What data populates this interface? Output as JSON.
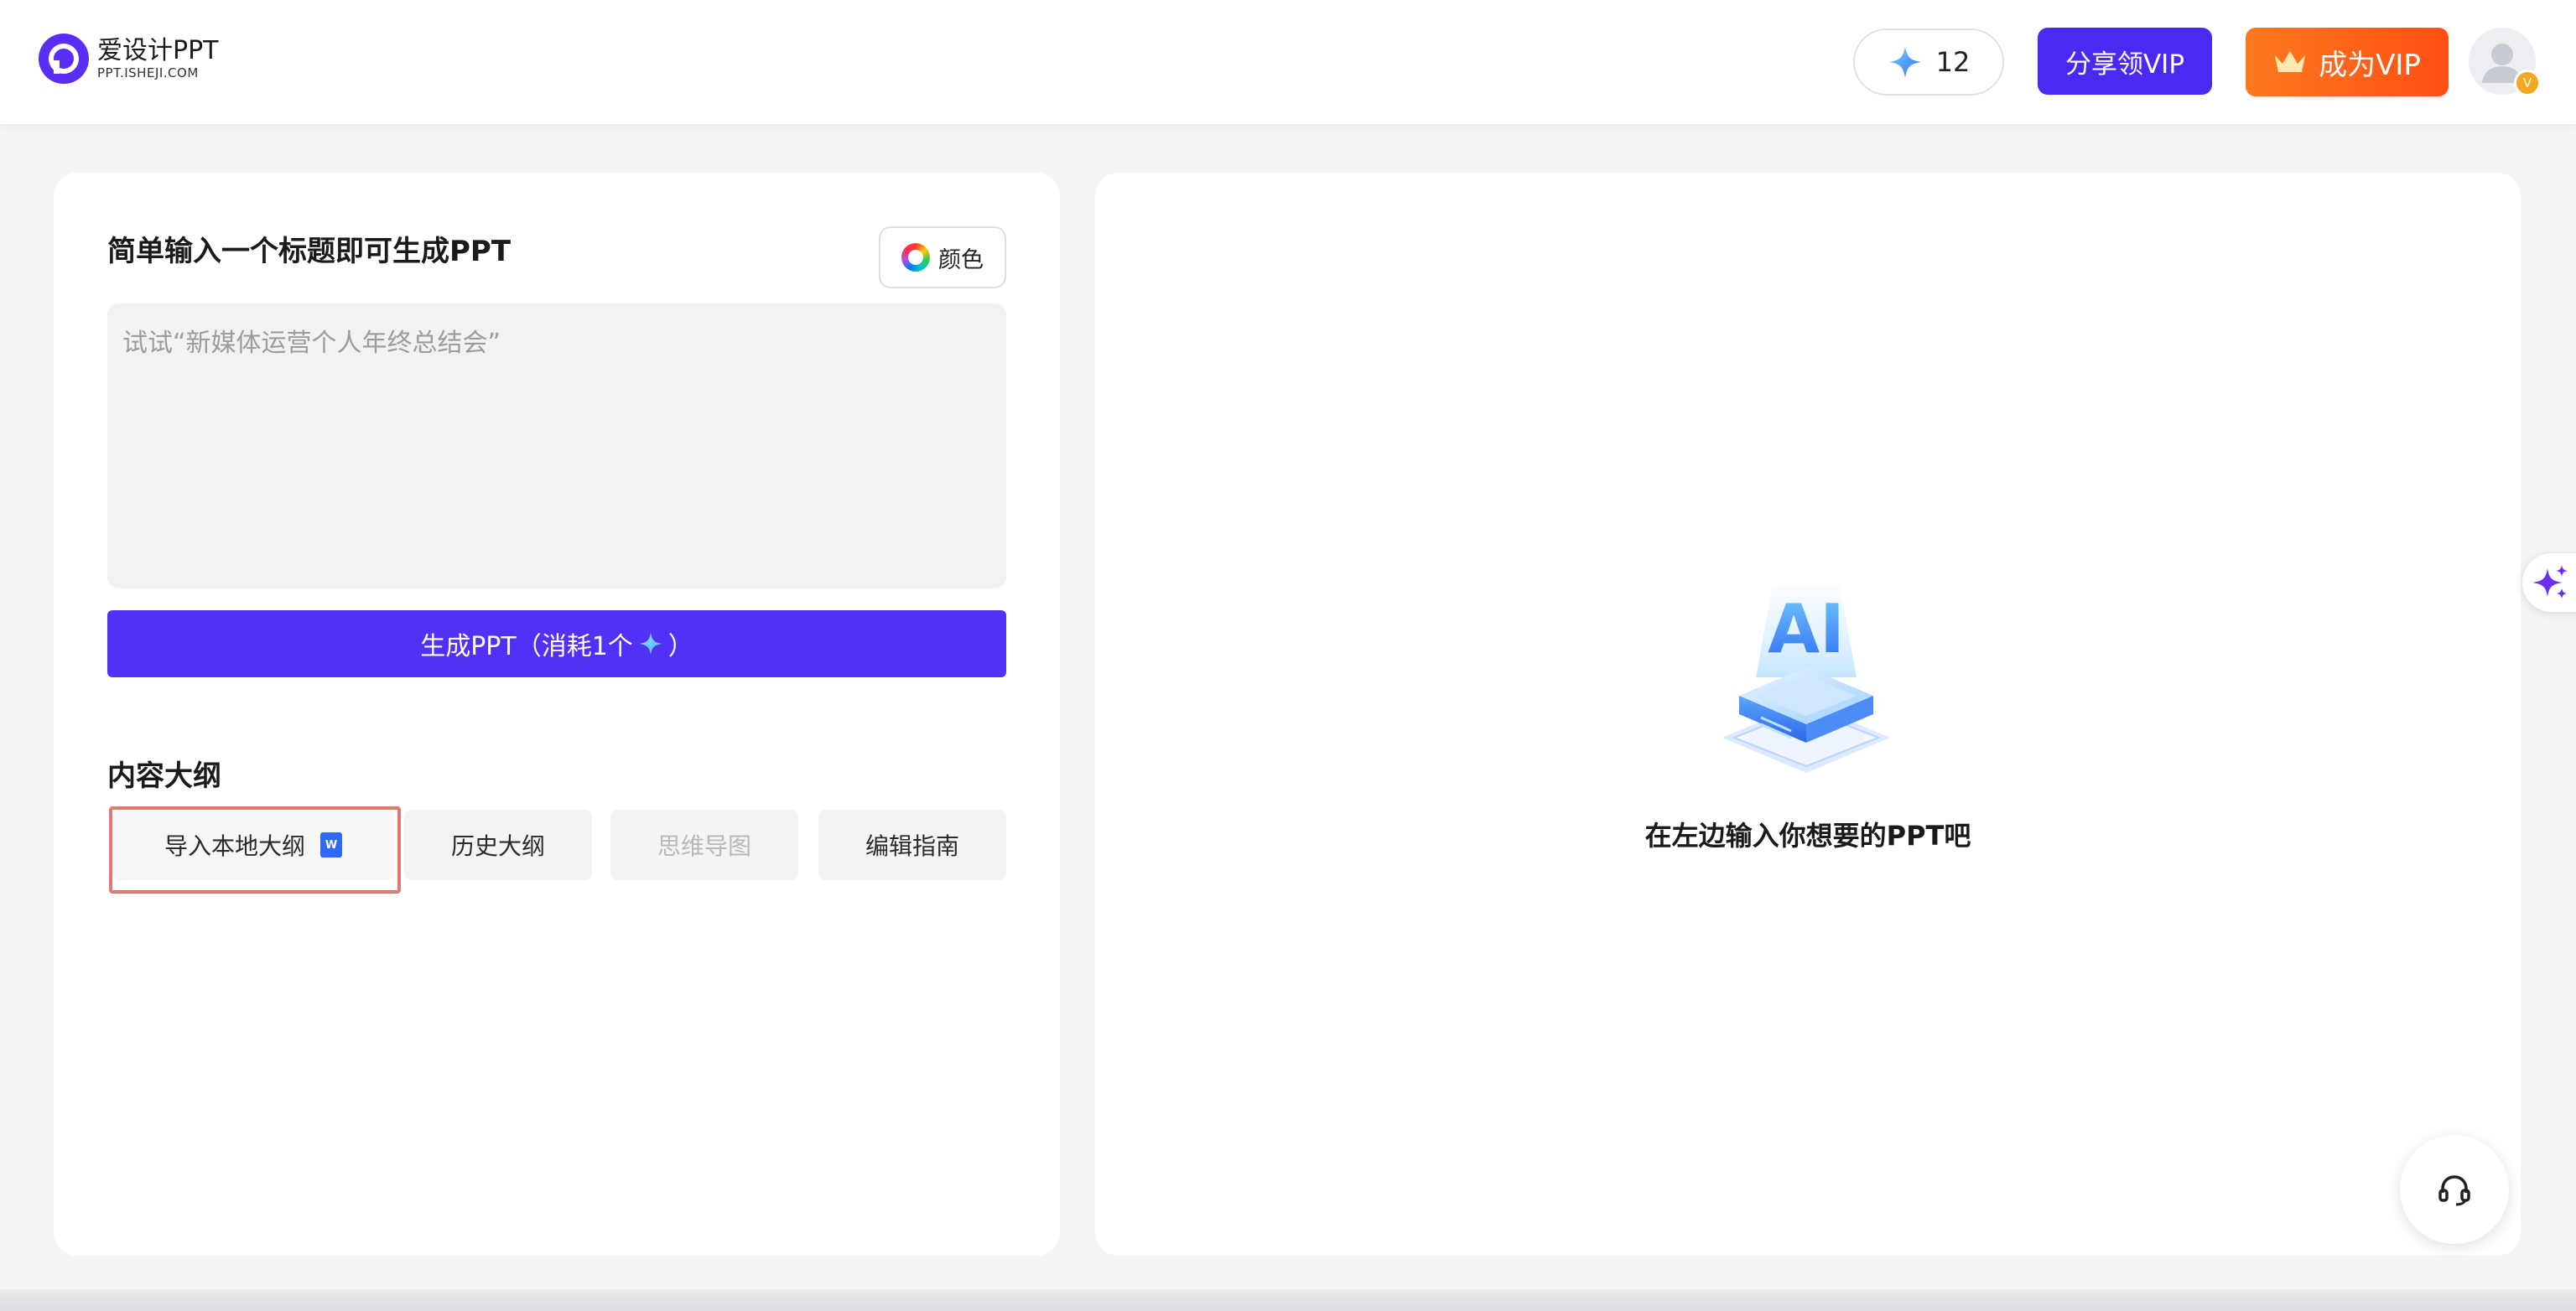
{
  "header": {
    "logo": {
      "name": "爱设计PPT",
      "domain": "PPT.ISHEJI.COM",
      "icon": "p-logo-icon",
      "color": "#5a2df5"
    },
    "credits": {
      "icon": "sparkle-icon",
      "value": "12"
    },
    "share_vip_label": "分享领VIP",
    "become_vip_label": "成为VIP",
    "avatar": {
      "icon": "user-avatar-icon",
      "badge": "V"
    }
  },
  "left_panel": {
    "title": "简单输入一个标题即可生成PPT",
    "color_button_label": "颜色",
    "topic_input": {
      "value": "",
      "placeholder": "试试“新媒体运营个人年终总结会”"
    },
    "generate_button": {
      "label_prefix": "生成PPT（消耗1个",
      "label_suffix": "）",
      "icon": "sparkle-icon",
      "color": "#5230f5"
    },
    "outline_title": "内容大纲",
    "outline_tabs": [
      {
        "label": "导入本地大纲",
        "icon": "word-doc-icon",
        "icon_text": "W",
        "highlighted": true
      },
      {
        "label": "历史大纲"
      },
      {
        "label": "思维导图",
        "disabled": true
      },
      {
        "label": "编辑指南"
      }
    ]
  },
  "right_panel": {
    "illustration": "ai-chip-illustration",
    "illustration_text": "AI",
    "empty_hint": "在左边输入你想要的PPT吧",
    "support_icon": "headset-icon",
    "side_ai_icon": "ai-sparkle-icon"
  },
  "colors": {
    "brand_purple": "#4a2af2",
    "vip_orange": "#ff6a1a",
    "highlight_red": "#e07a70"
  }
}
